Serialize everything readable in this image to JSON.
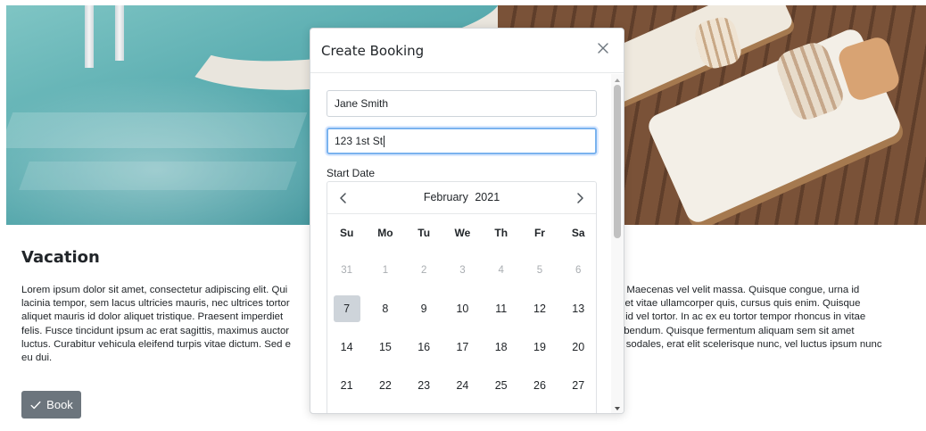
{
  "page": {
    "title": "Vacation",
    "paragraph_left": "Lorem ipsum dolor sit amet, consectetur adipiscing elit. Qui",
    "paragraph": [
      "Lorem ipsum dolor sit amet, consectetur adipiscing elit. Qui",
      "lacinia tempor, sem lacus ultricies mauris, nec ultrices tortor",
      "aliquet mauris id dolor aliquet tristique. Praesent imperdiet",
      "felis. Fusce tincidunt ipsum ac erat sagittis, maximus auctor",
      "luctus. Curabitur vehicula eleifend turpis vitae dictum. Sed e",
      "eu dui."
    ],
    "paragraph_right": [
      "pit. Maecenas vel velit massa. Quisque congue, urna id",
      "oreet vitae ullamcorper quis, cursus quis enim. Quisque",
      "sis id vel tortor. In ac ex eu tortor tempor rhoncus in vitae",
      "t bibendum. Quisque fermentum aliquam sem sit amet",
      "ttis sodales, erat elit scelerisque nunc, vel luctus ipsum nunc",
      ""
    ],
    "book_button_label": "Book",
    "book_button_icon": "check-icon"
  },
  "modal": {
    "title": "Create Booking",
    "close_icon": "close-icon",
    "name_value": "Jane Smith",
    "address_value": "123 1st St",
    "start_date_label": "Start Date"
  },
  "calendar": {
    "month": "February",
    "year": "2021",
    "weekdays": [
      "Su",
      "Mo",
      "Tu",
      "We",
      "Th",
      "Fr",
      "Sa"
    ],
    "weeks": [
      [
        {
          "d": "31",
          "m": true
        },
        {
          "d": "1",
          "m": true
        },
        {
          "d": "2",
          "m": true
        },
        {
          "d": "3",
          "m": true
        },
        {
          "d": "4",
          "m": true
        },
        {
          "d": "5",
          "m": true
        },
        {
          "d": "6",
          "m": true
        }
      ],
      [
        {
          "d": "7",
          "s": true
        },
        {
          "d": "8"
        },
        {
          "d": "9"
        },
        {
          "d": "10"
        },
        {
          "d": "11"
        },
        {
          "d": "12"
        },
        {
          "d": "13"
        }
      ],
      [
        {
          "d": "14"
        },
        {
          "d": "15"
        },
        {
          "d": "16"
        },
        {
          "d": "17"
        },
        {
          "d": "18"
        },
        {
          "d": "19"
        },
        {
          "d": "20"
        }
      ],
      [
        {
          "d": "21"
        },
        {
          "d": "22"
        },
        {
          "d": "23"
        },
        {
          "d": "24"
        },
        {
          "d": "25"
        },
        {
          "d": "26"
        },
        {
          "d": "27"
        }
      ]
    ],
    "selected_day": "7"
  },
  "colors": {
    "button_bg": "#6c757d",
    "focus_border": "#7ab3ee",
    "selected_day_bg": "#ced4da"
  }
}
